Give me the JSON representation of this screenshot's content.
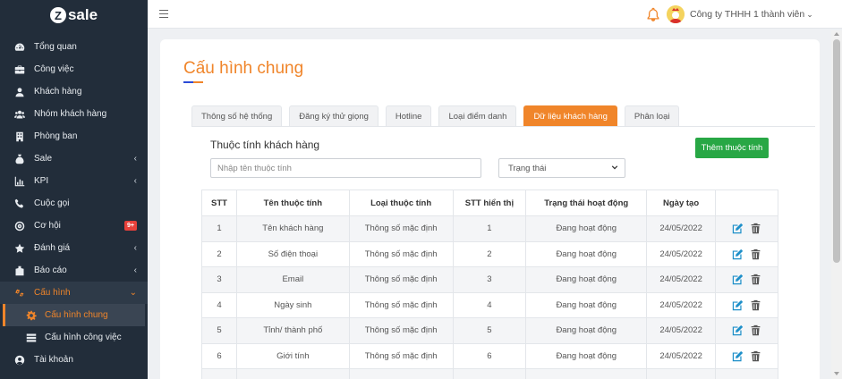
{
  "brand": {
    "logo_letter": "Z",
    "logo_text": "sale"
  },
  "sidebar": {
    "items": [
      {
        "label": "Tổng quan",
        "icon": "dashboard-icon"
      },
      {
        "label": "Công việc",
        "icon": "briefcase-icon"
      },
      {
        "label": "Khách hàng",
        "icon": "user-icon"
      },
      {
        "label": "Nhóm khách hàng",
        "icon": "users-icon"
      },
      {
        "label": "Phòng ban",
        "icon": "building-icon"
      },
      {
        "label": "Sale",
        "icon": "money-bag-icon",
        "chevron": "‹"
      },
      {
        "label": "KPI",
        "icon": "chart-icon",
        "chevron": "‹"
      },
      {
        "label": "Cuộc gọi",
        "icon": "phone-icon"
      },
      {
        "label": "Cơ hội",
        "icon": "target-icon",
        "badge": "9+"
      },
      {
        "label": "Đánh giá",
        "icon": "star-icon",
        "chevron": "‹"
      },
      {
        "label": "Báo cáo",
        "icon": "report-icon",
        "chevron": "‹"
      },
      {
        "label": "Cấu hình",
        "icon": "gears-icon",
        "chevron": "⌄"
      },
      {
        "label": "Tài khoản",
        "icon": "account-icon"
      }
    ],
    "submenu": [
      {
        "label": "Cấu hình chung",
        "icon": "gear-icon"
      },
      {
        "label": "Cấu hình công việc",
        "icon": "list-icon"
      }
    ]
  },
  "header": {
    "company": "Công ty THHH 1 thành viên",
    "caret": "⌄"
  },
  "page": {
    "title": "Cấu hình chung",
    "tabs": [
      "Thông số hệ thống",
      "Đăng ký thử giọng",
      "Hotline",
      "Loại điểm danh",
      "Dữ liệu khách hàng",
      "Phân loại"
    ],
    "active_tab": "Dữ liệu khách hàng",
    "section_title": "Thuộc tính khách hàng",
    "add_button": "Thêm thuộc tính",
    "search_placeholder": "Nhập tên thuộc tính",
    "status_select": "Trạng thái"
  },
  "table": {
    "headers": [
      "STT",
      "Tên thuộc tính",
      "Loại thuộc tính",
      "STT hiển thị",
      "Trạng thái hoạt động",
      "Ngày tạo",
      ""
    ],
    "rows": [
      [
        "1",
        "Tên khách hàng",
        "Thông số mặc định",
        "1",
        "Đang hoạt động",
        "24/05/2022"
      ],
      [
        "2",
        "Số điện thoại",
        "Thông số mặc định",
        "2",
        "Đang hoạt động",
        "24/05/2022"
      ],
      [
        "3",
        "Email",
        "Thông số mặc định",
        "3",
        "Đang hoạt động",
        "24/05/2022"
      ],
      [
        "4",
        "Ngày sinh",
        "Thông số mặc định",
        "4",
        "Đang hoạt động",
        "24/05/2022"
      ],
      [
        "5",
        "Tỉnh/ thành phố",
        "Thông số mặc định",
        "5",
        "Đang hoạt động",
        "24/05/2022"
      ],
      [
        "6",
        "Giới tính",
        "Thông số mặc định",
        "6",
        "Đang hoạt động",
        "24/05/2022"
      ]
    ]
  },
  "colors": {
    "accent": "#f0852a",
    "sidebar_bg": "#222d3a",
    "success": "#28a745",
    "edit_icon": "#1d8fc9",
    "delete_icon": "#555555"
  }
}
